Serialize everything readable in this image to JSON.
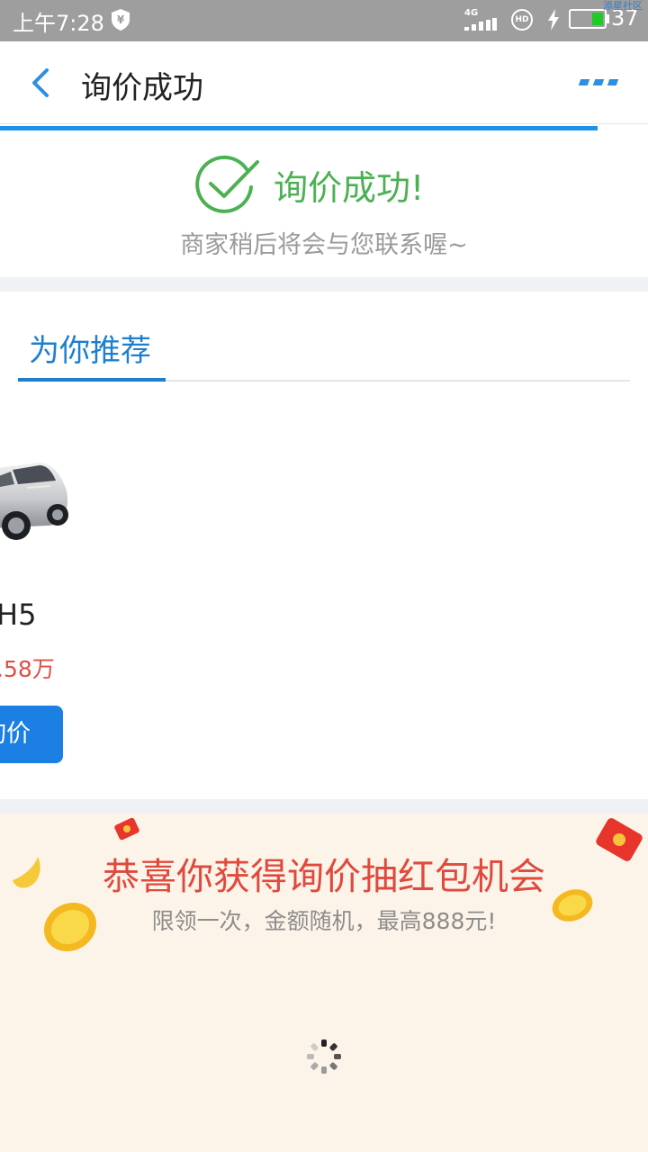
{
  "status_bar": {
    "time": "上午7:28",
    "network": "4G",
    "hd": "HD",
    "battery": "37",
    "watermark": "添星社区"
  },
  "nav": {
    "title": "询价成功",
    "back_icon": "back-chevron-icon",
    "more_icon": "more-dots-icon"
  },
  "success": {
    "title": "询价成功!",
    "subtitle": "商家稍后将会与您联系喔~"
  },
  "recommend": {
    "tab_label": "为你推荐",
    "car": {
      "name": "H5",
      "price": ".58万",
      "button_label": "询价"
    }
  },
  "promo": {
    "title": "恭喜你获得询价抽红包机会",
    "subtitle": "限领一次，金额随机，最高888元!"
  },
  "colors": {
    "accent": "#1e7fcf",
    "success": "#4cb152",
    "price": "#e04e43",
    "promo_bg": "#fdf4e9"
  }
}
